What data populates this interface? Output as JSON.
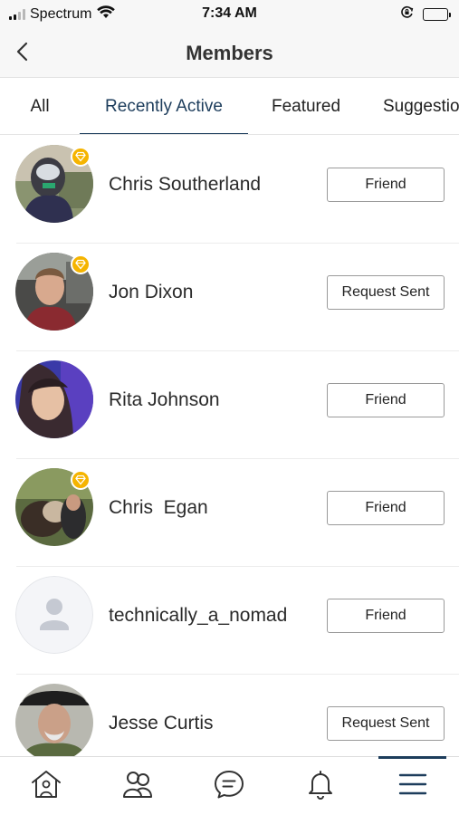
{
  "status_bar": {
    "carrier": "Spectrum",
    "time": "7:34 AM",
    "icons": [
      "signal-icon",
      "wifi-icon",
      "orientation-lock-icon",
      "battery-icon"
    ]
  },
  "header": {
    "title": "Members",
    "back_icon": "chevron-left-icon"
  },
  "tabs": [
    {
      "label": "All",
      "active": false
    },
    {
      "label": "Recently Active",
      "active": true
    },
    {
      "label": "Featured",
      "active": false
    },
    {
      "label": "Suggestions",
      "active": false
    }
  ],
  "members": [
    {
      "name": "Chris Southerland",
      "action": "Friend",
      "badge": true
    },
    {
      "name": "Jon Dixon",
      "action": "Request Sent",
      "badge": true
    },
    {
      "name": "Rita Johnson",
      "action": "Friend",
      "badge": false
    },
    {
      "name": "Chris  Egan",
      "action": "Friend",
      "badge": true
    },
    {
      "name": "technically_a_nomad",
      "action": "Friend",
      "badge": false
    },
    {
      "name": "Jesse Curtis",
      "action": "Request Sent",
      "badge": false
    }
  ],
  "bottom_nav": [
    {
      "icon": "home-icon",
      "active": false
    },
    {
      "icon": "groups-icon",
      "active": false
    },
    {
      "icon": "messages-icon",
      "active": false
    },
    {
      "icon": "notifications-icon",
      "active": false
    },
    {
      "icon": "menu-icon",
      "active": true
    }
  ],
  "colors": {
    "accent": "#1d3d5c",
    "badge": "#f5b400",
    "header_bg": "#f7f7f7"
  }
}
